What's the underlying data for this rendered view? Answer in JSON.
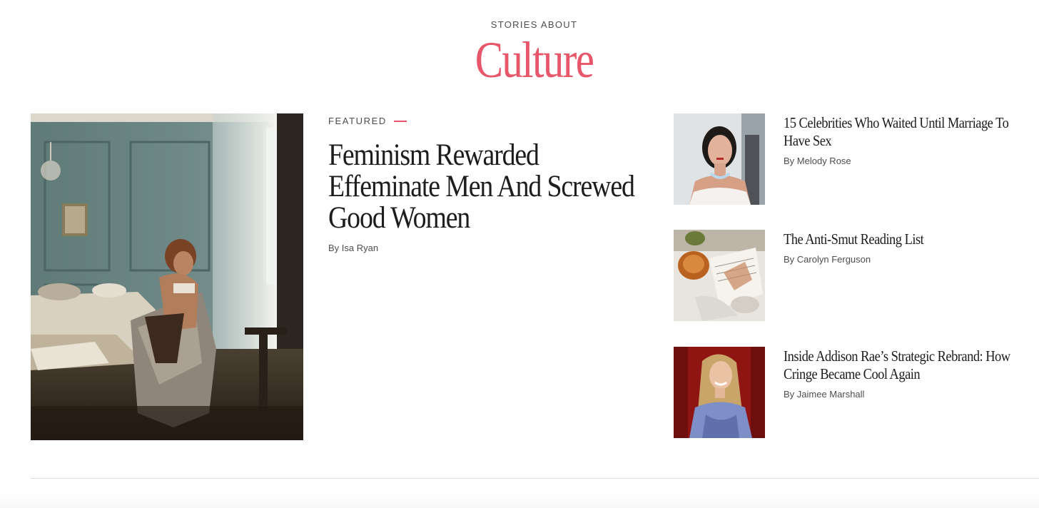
{
  "section": {
    "eyebrow": "STORIES ABOUT",
    "title": "Culture",
    "accent_color": "#e8566a"
  },
  "featured": {
    "label": "FEATURED",
    "headline": "Feminism Rewarded Effeminate Men And Screwed Good Women",
    "byline": "By Isa Ryan",
    "image_icon": "photo-woman-in-bedroom"
  },
  "stories": [
    {
      "headline": "15 Celebrities Who Waited Until Marriage To Have Sex",
      "byline": "By Melody Rose",
      "image_icon": "photo-celebrity-red-carpet"
    },
    {
      "headline": "The Anti-Smut Reading List",
      "byline": "By Carolyn Ferguson",
      "image_icon": "photo-book-and-tea"
    },
    {
      "headline": "Inside Addison Rae’s Strategic Rebrand: How Cringe Became Cool Again",
      "byline": "By Jaimee Marshall",
      "image_icon": "photo-addison-rae"
    }
  ]
}
